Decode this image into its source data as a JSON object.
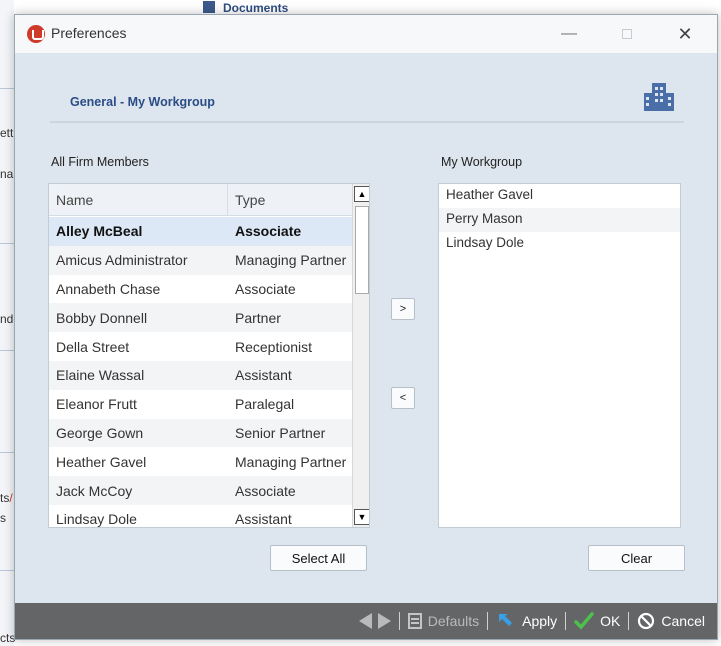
{
  "background": {
    "documents_label": "Documents",
    "fragments": [
      "ett",
      "nai",
      "nde",
      "ts",
      "/",
      "s",
      "cts"
    ]
  },
  "window": {
    "title": "Preferences",
    "minimize": "—",
    "close": "✕"
  },
  "header": {
    "title": "General - My Workgroup"
  },
  "left_panel": {
    "label": "All Firm Members",
    "columns": [
      "Name",
      "Type"
    ],
    "rows": [
      {
        "name": "Alley McBeal",
        "type": "Associate"
      },
      {
        "name": "Amicus Administrator",
        "type": "Managing Partner"
      },
      {
        "name": "Annabeth Chase",
        "type": "Associate"
      },
      {
        "name": "Bobby Donnell",
        "type": "Partner"
      },
      {
        "name": "Della Street",
        "type": "Receptionist"
      },
      {
        "name": "Elaine Wassal",
        "type": "Assistant"
      },
      {
        "name": "Eleanor Frutt",
        "type": "Paralegal"
      },
      {
        "name": "George Gown",
        "type": "Senior Partner"
      },
      {
        "name": "Heather Gavel",
        "type": "Managing Partner"
      },
      {
        "name": "Jack McCoy",
        "type": "Associate"
      },
      {
        "name": "Lindsay Dole",
        "type": "Assistant"
      }
    ],
    "select_all": "Select All"
  },
  "move_buttons": {
    "add": ">",
    "remove": "<"
  },
  "right_panel": {
    "label": "My Workgroup",
    "items": [
      "Heather Gavel",
      "Perry Mason",
      "Lindsay Dole"
    ],
    "clear": "Clear"
  },
  "footer": {
    "defaults": "Defaults",
    "apply": "Apply",
    "ok": "OK",
    "cancel": "Cancel"
  },
  "colors": {
    "accent": "#2b4c86",
    "dialog_bg": "#dde6ee",
    "footer_bg": "#646567",
    "selected_row": "#dce8f6"
  }
}
